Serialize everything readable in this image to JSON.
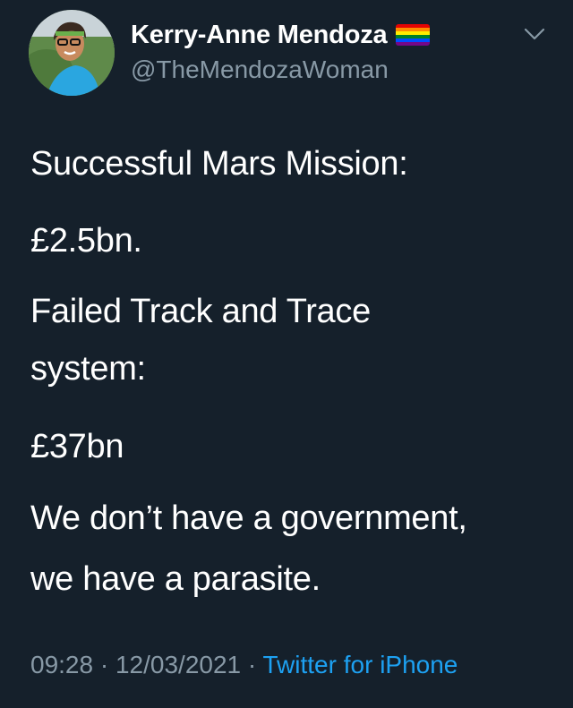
{
  "author": {
    "display_name": "Kerry-Anne Mendoza",
    "handle": "@TheMendozaWoman",
    "badge_icon": "rainbow-flag-icon"
  },
  "tweet": {
    "lines": [
      "Successful Mars Mission:",
      "£2.5bn.",
      "Failed Track and Trace",
      "system:",
      "£37bn",
      "We don’t have a government,",
      "we have a parasite."
    ],
    "time": "09:28",
    "separator": "·",
    "date": "12/03/2021",
    "source": "Twitter for iPhone"
  },
  "colors": {
    "background": "#15202b",
    "text": "#ffffff",
    "secondary_text": "#8899a6",
    "link": "#1da1f2"
  },
  "icons": {
    "menu": "chevron-down-icon"
  }
}
